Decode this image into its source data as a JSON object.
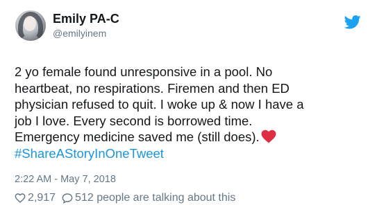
{
  "author": {
    "name": "Emily PA-C",
    "handle": "@emilyinem"
  },
  "icons": {
    "platform": "twitter-bird-icon",
    "heart_emoji": "red-heart-emoji",
    "like": "heart-outline-icon",
    "reply": "speech-bubble-icon"
  },
  "tweet": {
    "lines": [
      "2 yo female found unresponsive in a pool. No",
      "heartbeat, no respirations. Firemen and then ED",
      "physician refused to quit. I woke up & now I have a",
      "job I love. Every second is borrowed time.",
      "Emergency medicine saved me (still does)."
    ],
    "hashtag": "#ShareAStoryInOneTweet"
  },
  "timestamp": "2:22 AM - May 7, 2018",
  "stats": {
    "likes": "2,917",
    "replies_text": "512 people are talking about this"
  },
  "colors": {
    "text": "#14171a",
    "secondary": "#657786",
    "link": "#1b95e0",
    "twitter_blue": "#1da1f2",
    "heart_red": "#dd2e44"
  }
}
